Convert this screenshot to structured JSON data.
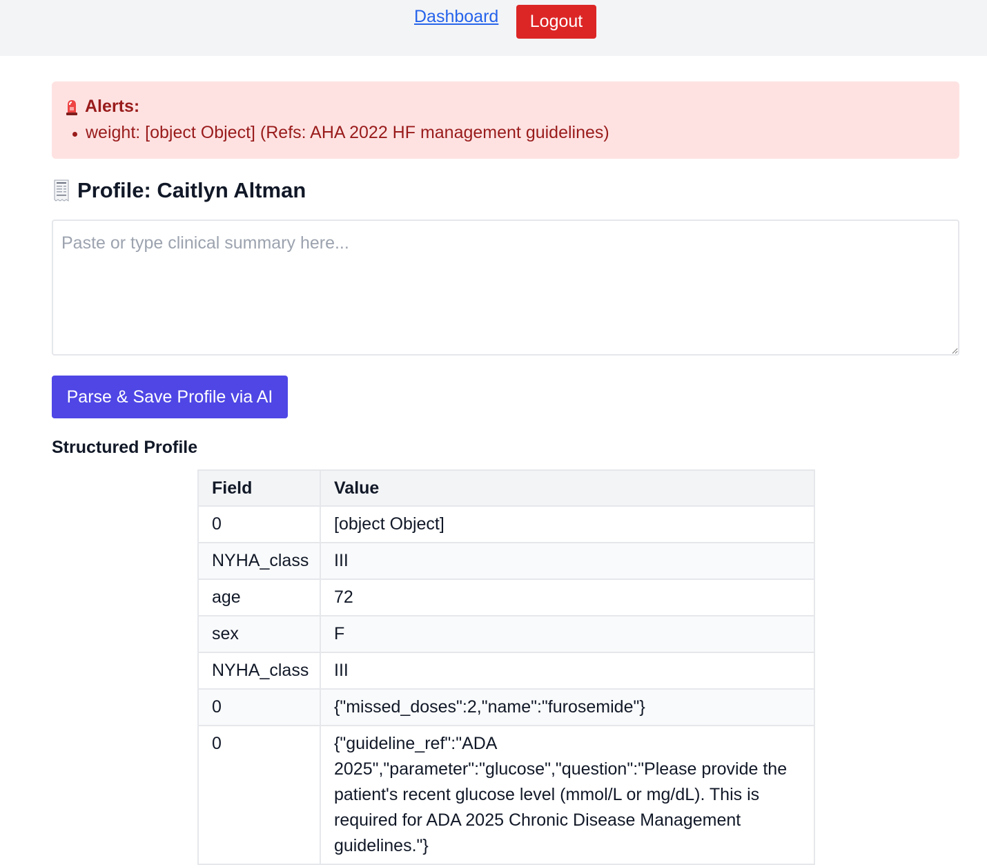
{
  "nav": {
    "dashboard_label": "Dashboard",
    "logout_label": "Logout"
  },
  "alerts": {
    "title": "Alerts:",
    "icon": "siren-icon",
    "items": [
      "weight: [object Object] (Refs: AHA 2022 HF management guidelines)"
    ]
  },
  "profile": {
    "heading": "Profile: Caitlyn Altman",
    "icon": "receipt-icon",
    "textarea_placeholder": "Paste or type clinical summary here...",
    "textarea_value": "",
    "parse_button_label": "Parse & Save Profile via AI"
  },
  "structured": {
    "title": "Structured Profile",
    "headers": [
      "Field",
      "Value"
    ],
    "rows": [
      {
        "field": "0",
        "value": "[object Object]"
      },
      {
        "field": "NYHA_class",
        "value": "III"
      },
      {
        "field": "age",
        "value": "72"
      },
      {
        "field": "sex",
        "value": "F"
      },
      {
        "field": "NYHA_class",
        "value": "III"
      },
      {
        "field": "0",
        "value": "{\"missed_doses\":2,\"name\":\"furosemide\"}"
      },
      {
        "field": "0",
        "value": "{\"guideline_ref\":\"ADA 2025\",\"parameter\":\"glucose\",\"question\":\"Please provide the patient's recent glucose level (mmol/L or mg/dL). This is required for ADA 2025 Chronic Disease Management guidelines.\"}"
      }
    ]
  },
  "colors": {
    "nav_bg": "#f3f4f6",
    "link": "#2563eb",
    "logout_bg": "#dc2626",
    "alert_bg": "#fee2e2",
    "alert_text": "#991b1b",
    "primary_button": "#4f46e5",
    "table_header_bg": "#f3f4f6",
    "table_border": "#e5e7eb"
  }
}
